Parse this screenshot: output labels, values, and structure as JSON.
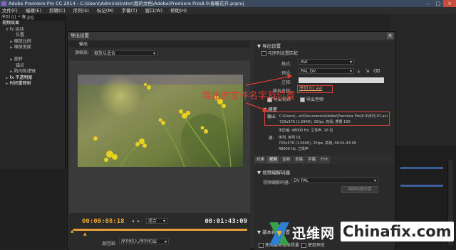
{
  "window": {
    "title": "Adobe Premiere Pro CC 2014 - C:\\Users\\Administrator\\我的文档\\Adobe\\Premiere Pro\\8.0\\春暖花开.prproj"
  },
  "menu": [
    "文件(F)",
    "编辑(E)",
    "剪辑(C)",
    "序列(S)",
    "标记(M)",
    "字幕(T)",
    "窗口(W)",
    "帮助(H)"
  ],
  "left_panel": {
    "header": "序列 01 * 春.jpg",
    "rows": [
      "视频效果",
      "运动",
      "位置",
      "缩放比例",
      "缩放宽度",
      "旋转",
      "锚点",
      "防闪烁滤镜",
      "不透明度",
      "时间重映射"
    ]
  },
  "dialog": {
    "title": "导出设置",
    "close": "×",
    "tab_output": "输出",
    "source_scale_label": "源缩放:",
    "source_scale_value": "缩放以适合",
    "left_timecode": "00:00:08:18",
    "right_timecode": "00:01:43:09",
    "fit_value": "适合",
    "source_range_label": "源范围:",
    "source_range_value": "序列切入/序列切出",
    "export_settings_header": "导出设置",
    "match_sequence_label": "与序列设置匹配",
    "format_label": "格式:",
    "format_value": "AVI",
    "preset_label": "预设:",
    "preset_value": "PAL DV",
    "comment_label": "注释:",
    "output_name_label": "输出名称:",
    "output_name_value": "序列 01.avi",
    "export_video_label": "导出视频",
    "export_audio_label": "导出音频",
    "summary_header": "摘要",
    "summary_output_label": "输出:",
    "summary_output_lines": [
      "C:\\Users\\...or\\Documents\\Adobe\\Premiere Pro\\8.0\\序列 01.avi",
      "720x576 (1.0940), 25fps, 高场, 质量 100"
    ],
    "summary_mid_line": "未压缩: 48000 Hz, 立体声, 16 位",
    "summary_source_label": "源:",
    "summary_source_lines": [
      "序列, 序列 01",
      "720x576 (1.0940), 25fps, 高场, 00:01:43:09",
      "48000 Hz, 立体声"
    ],
    "lower_tabs": [
      "效果",
      "视频",
      "音频",
      "多路",
      "字幕",
      "FTP"
    ],
    "video_codec_header": "视频编解码器",
    "video_codec_label": "视频编解码器:",
    "video_codec_value": "DV PAL",
    "codec_settings_button": "编解码器设置",
    "basic_video_header": "基本视频设置",
    "max_render_quality_label": "使用最高渲染质量",
    "use_preview_label": "使用预览"
  },
  "annotation": {
    "text": "导出的文件名字及位置"
  },
  "watermark": {
    "cn": "迅维网",
    "en": "Chinafix.com"
  },
  "colors": {
    "accent_link": "#e9a66a",
    "annotation_red": "#e23b2e",
    "timecode_orange": "#e8a13a"
  }
}
